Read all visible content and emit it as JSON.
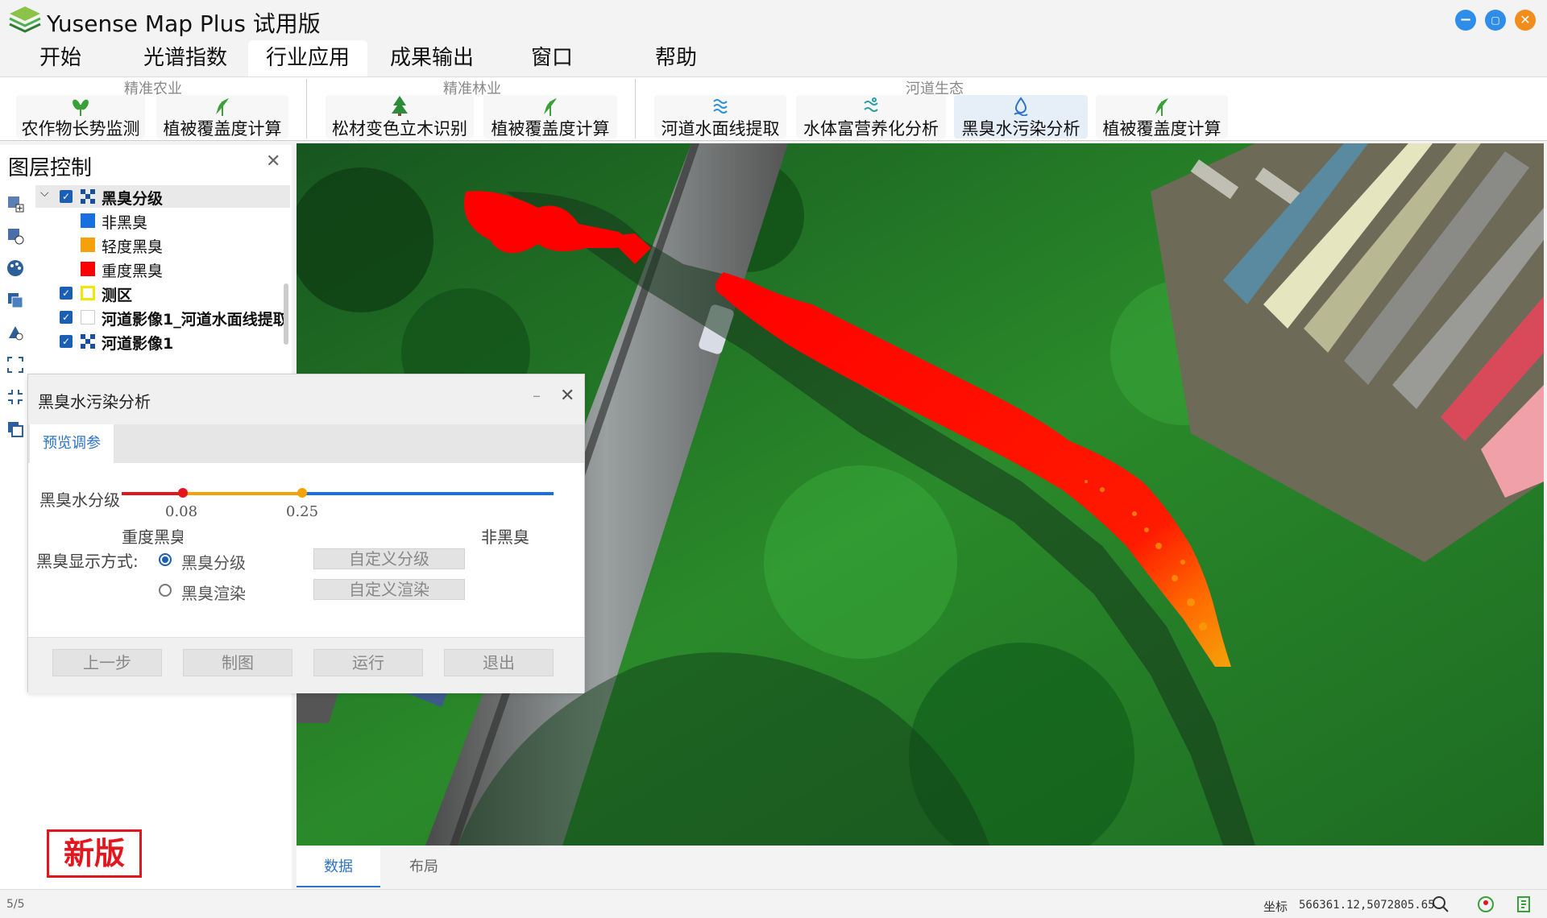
{
  "app": {
    "title": "Yusense Map Plus 试用版"
  },
  "menu": [
    "开始",
    "光谱指数",
    "行业应用",
    "成果输出",
    "窗口",
    "帮助"
  ],
  "ribbon": {
    "groups": [
      {
        "label": "精准农业",
        "buttons": [
          "农作物长势监测",
          "植被覆盖度计算"
        ]
      },
      {
        "label": "精准林业",
        "buttons": [
          "松材变色立木识别",
          "植被覆盖度计算"
        ]
      },
      {
        "label": "河道生态",
        "buttons": [
          "河道水面线提取",
          "水体富营养化分析",
          "黑臭水污染分析",
          "植被覆盖度计算"
        ]
      }
    ],
    "selected_button": "黑臭水污染分析"
  },
  "layer_panel": {
    "title": "图层控制",
    "tree": [
      {
        "label": "黑臭分级",
        "checked": true,
        "expanded": true,
        "bold": true
      },
      {
        "label": "非黑臭",
        "legend_color": "#1a6fe0"
      },
      {
        "label": "轻度黑臭",
        "legend_color": "#f5a20a"
      },
      {
        "label": "重度黑臭",
        "legend_color": "#ff0000"
      },
      {
        "label": "测区",
        "checked": true,
        "bold": true
      },
      {
        "label": "河道影像1_河道水面线提取",
        "checked": true,
        "bold": true
      },
      {
        "label": "河道影像1",
        "checked": true,
        "bold": true
      }
    ]
  },
  "dialog": {
    "title": "黑臭水污染分析",
    "tab": "预览调参",
    "slider_label": "黑臭水分级",
    "thresholds": [
      "0.08",
      "0.25"
    ],
    "left_end": "重度黑臭",
    "right_end": "非黑臭",
    "display_mode_label": "黑臭显示方式:",
    "options": [
      {
        "label": "黑臭分级",
        "selected": true,
        "action": "自定义分级"
      },
      {
        "label": "黑臭渲染",
        "selected": false,
        "action": "自定义渲染"
      }
    ],
    "footer_buttons": [
      "上一步",
      "制图",
      "运行",
      "退出"
    ]
  },
  "badge": "新版",
  "bottom_tabs": [
    "数据",
    "布局"
  ],
  "status": {
    "page": "5/5",
    "coord_label": "坐标",
    "coord_value": "566361.12,5072805.65"
  },
  "colors": {
    "accent": "#2d73c8",
    "severe": "#ff0000",
    "mild": "#f5a20a",
    "clean": "#1a6fe0",
    "badge": "#e3161e"
  }
}
